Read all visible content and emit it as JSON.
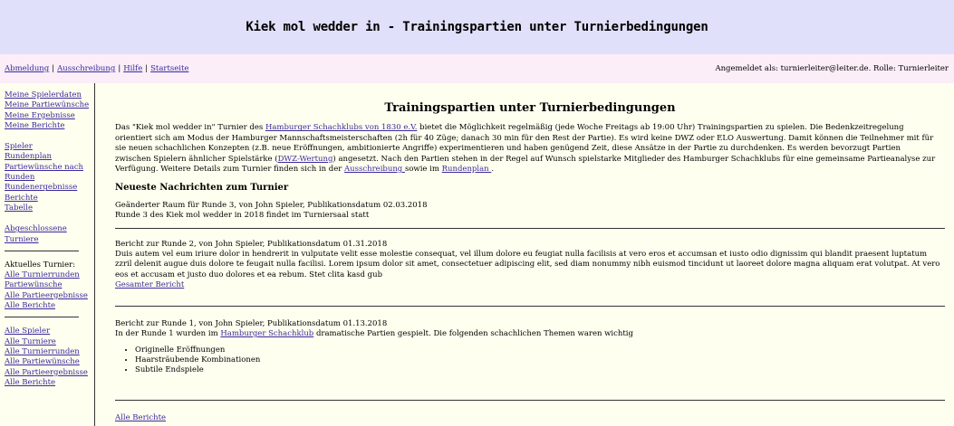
{
  "banner_title": "Kiek mol wedder in - Trainingspartien unter Turnierbedingungen",
  "topbar": {
    "links": [
      "Abmeldung",
      "Ausschreibung",
      "Hilfe",
      "Startseite"
    ],
    "login_info": "Angemeldet als: turnierleiter@leiter.de. Rolle: Turnierleiter"
  },
  "sidebar": {
    "group1": [
      "Meine Spielerdaten",
      "Meine Partiewünsche",
      "Meine Ergebnisse",
      "Meine Berichte"
    ],
    "group2": [
      "Spieler",
      "Rundenplan",
      "Partiewünsche nach Runden",
      "Rundenergebnisse",
      "Berichte",
      "Tabelle"
    ],
    "group3": [
      "Abgeschlossene Turniere"
    ],
    "current_label": "Aktuelles Turnier:",
    "group4": [
      "Alle Turnierrunden",
      "Partiewünsche",
      "Alle Partieergebnisse",
      "Alle Berichte"
    ],
    "group5": [
      "Alle Spieler",
      "Alle Turniere",
      "Alle Turnierrunden",
      "Alle Partiewünsche",
      "Alle Partieergebnisse",
      "Alle Berichte"
    ]
  },
  "content": {
    "heading": "Trainingspartien unter Turnierbedingungen",
    "intro": {
      "t1": "Das \"Kiek mol wedder in\" Turnier des ",
      "link1": "Hamburger Schachklubs von 1830 e.V.",
      "t2": " bietet die Möglichkeit regelmäßig (jede Woche Freitags ab 19:00 Uhr) Trainingspartien zu spielen. Die Bedenkzeitregelung orientiert sich am Modus der Hamburger Mannschaftsmeisterschaften (2h für 40 Züge; danach 30 min für den Rest der Partie). Es wird keine DWZ oder ELO Auswertung. Damit können die Teilnehmer mit für sie neuen schachlichen Konzepten (z.B. neue Eröffnungen, ambitionierte Angriffe) experimentieren und haben genügend Zeit, diese Ansätze in der Partie zu durchdenken. Es werden bevorzugt Partien zwischen Spielern ähnlicher Spielstärke (",
      "link2": "DWZ-Wertung",
      "t3": ") angesetzt. Nach den Partien stehen in der Regel auf Wunsch spielstarke Mitglieder des Hamburger Schachklubs für eine gemeinsame Partieanalyse zur Verfügung. Weitere Details zum Turnier finden sich in der ",
      "link3": "Ausschreibung ",
      "t4": " sowie im ",
      "link4": "Rundenplan ",
      "t5": "."
    },
    "news_heading": "Neueste Nachrichten zum Turnier",
    "news": [
      {
        "title": "Geänderter Raum für Runde 3, von John Spieler, Publikationsdatum 02.03.2018",
        "body": "Runde 3 des Kiek mol wedder in 2018 findet im Turniersaal statt"
      },
      {
        "title": "Bericht zur Runde 2, von John Spieler, Publikationsdatum 01.31.2018",
        "body": "Duis autem vel eum iriure dolor in hendrerit in vulputate velit esse molestie consequat, vel illum dolore eu feugiat nulla facilisis at vero eros et accumsan et iusto odio dignissim qui blandit praesent luptatum zzril delenit augue duis dolore te feugait nulla facilisi. Lorem ipsum dolor sit amet, consectetuer adipiscing elit, sed diam nonummy nibh euismod tincidunt ut laoreet dolore magna aliquam erat volutpat. At vero eos et accusam et justo duo dolores et ea rebum. Stet clita kasd gub",
        "link": "Gesamter Bericht"
      },
      {
        "title": "Bericht zur Runde 1, von John Spieler, Publikationsdatum 01.13.2018",
        "body_pre": "In der Runde 1 wurden im ",
        "body_link": "Hamburger Schachklub",
        "body_post": " dramatische Partien gespielt. Die folgenden schachlichen Themen waren wichtig",
        "bullets": [
          "Originelle Eröffnungen",
          "Haarsträubende Kombinationen",
          "Subtile Endspiele"
        ]
      }
    ],
    "all_reports": "Alle Berichte"
  }
}
